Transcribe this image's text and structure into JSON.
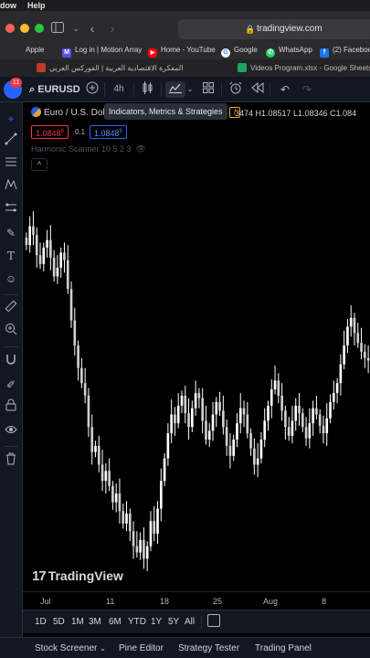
{
  "menubar": {
    "left_item": "dow",
    "right_item": "Help"
  },
  "browser": {
    "url": "tradingview.com",
    "icons": [
      "sidebar-icon",
      "chevron-down-icon",
      "back-icon",
      "forward-icon",
      "lock-icon"
    ]
  },
  "bookmarks": [
    {
      "label": "Apple",
      "color": "#e5e5e5",
      "glyph": ""
    },
    {
      "label": "Log in | Motion Array",
      "color": "#5b4ee6",
      "glyph": "M"
    },
    {
      "label": "Home - YouTube",
      "color": "#ff0000",
      "glyph": "▶"
    },
    {
      "label": "Google",
      "color": "#ffffff",
      "glyph": "G"
    },
    {
      "label": "WhatsApp",
      "color": "#25d366",
      "glyph": "✆"
    },
    {
      "label": "(2) Faceboo",
      "color": "#1877f2",
      "glyph": "f"
    }
  ],
  "tabs": [
    {
      "label": "المفكرة الاقتصادية العربية | الفوركس العربي",
      "color": "#c0392b"
    },
    {
      "label": "Videos Program.xlsx - Google Sheets",
      "color": "#1fa463"
    }
  ],
  "header": {
    "badge": "11",
    "symbol": "EURUSD",
    "interval": "4h",
    "tooltip": "Indicators, Metrics & Strategies"
  },
  "legend": {
    "title": "Euro / U.S. Dol",
    "ohlc_visible": "3474  H1.08517  L1.08346  C1.084",
    "orange_badge": "/",
    "sell_price": "1.0848",
    "sell_sup": "8",
    "spread": "0.1",
    "buy_price": "1.0848",
    "buy_sup": "9",
    "study": "Harmonic Scanner  10  5  2  3",
    "collapse": "^"
  },
  "watermark": "TradingView",
  "time_axis": [
    "Jul",
    "11",
    "18",
    "25",
    "Aug",
    "8"
  ],
  "ranges": [
    "1D",
    "5D",
    "1M",
    "3M",
    "6M",
    "YTD",
    "1Y",
    "5Y",
    "All"
  ],
  "bottom_tabs": [
    "Stock Screener",
    "Pine Editor",
    "Strategy Tester",
    "Trading Panel"
  ],
  "colors": {
    "bg": "#000000",
    "panel": "#131722",
    "candle": "#ffffff",
    "accent": "#2962ff",
    "sell": "#f23645"
  },
  "chart_data": {
    "type": "candlestick",
    "symbol": "EURUSD",
    "interval": "4h",
    "candle_closes": [
      1.094,
      1.0955,
      1.0948,
      1.0932,
      1.0925,
      1.0938,
      1.0944,
      1.093,
      1.0915,
      1.0922,
      1.0934,
      1.0928,
      1.0905,
      1.088,
      1.086,
      1.0842,
      1.083,
      1.082,
      1.0795,
      1.0775,
      1.078,
      1.0765,
      1.0752,
      1.076,
      1.0748,
      1.0735,
      1.0742,
      1.0728,
      1.0718,
      1.0726,
      1.0712,
      1.07,
      1.0695,
      1.0705,
      1.069,
      1.07,
      1.072,
      1.071,
      1.073,
      1.0752,
      1.077,
      1.079,
      1.0805,
      1.0798,
      1.0812,
      1.082,
      1.0806,
      1.0795,
      1.081,
      1.0822,
      1.0818,
      1.08,
      1.0785,
      1.0792,
      1.0805,
      1.0815,
      1.0808,
      1.0795,
      1.078,
      1.0772,
      1.0785,
      1.0798,
      1.081,
      1.0805,
      1.079,
      1.0778,
      1.0765,
      1.077,
      1.0785,
      1.08,
      1.0812,
      1.0825,
      1.0832,
      1.082,
      1.0808,
      1.0795,
      1.0788,
      1.08,
      1.0812,
      1.0806,
      1.0795,
      1.0786,
      1.0798,
      1.081,
      1.0805,
      1.0796,
      1.079,
      1.0802,
      1.0815,
      1.0822,
      1.083,
      1.0845,
      1.086,
      1.0875,
      1.0882,
      1.087,
      1.0862,
      1.0855,
      1.085,
      1.0848
    ]
  }
}
